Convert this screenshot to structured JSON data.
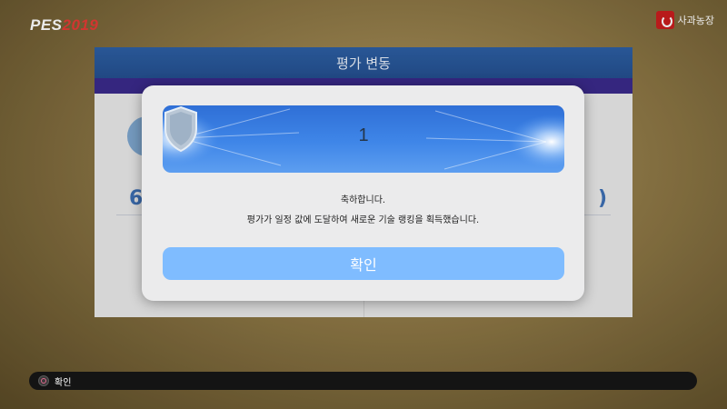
{
  "logo": {
    "brand": "PES",
    "year": "2019"
  },
  "watermark": {
    "text": "사과농장",
    "icon": "apple-farm-icon"
  },
  "background_panel": {
    "title": "평가 변동",
    "left_number": "6",
    "right_number": ")"
  },
  "dialog": {
    "rank_number": "1",
    "badge_icon": "shield-icon",
    "message_line1": "축하합니다.",
    "message_line2": "평가가 일정 값에 도달하여 새로운 기술 랭킹을 획득했습니다.",
    "confirm_label": "확인"
  },
  "bottom_bar": {
    "button_icon": "circle-button-icon",
    "label": "확인"
  },
  "colors": {
    "button_blue": "#7fbcff",
    "header_blue": "#2d5fa3",
    "logo_red": "#e33b35"
  }
}
